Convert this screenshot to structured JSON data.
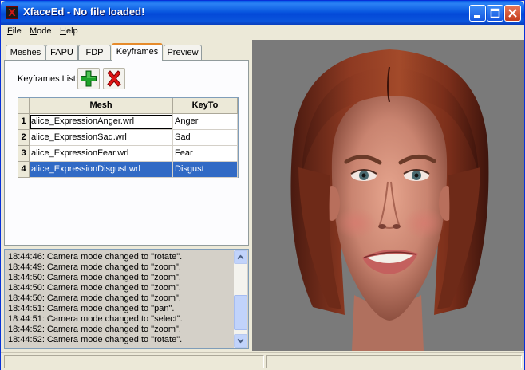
{
  "window": {
    "title": "XfaceEd - No file loaded!",
    "app_icon": "X"
  },
  "menu": [
    {
      "label": "File",
      "accel": "F",
      "rest": "ile"
    },
    {
      "label": "Mode",
      "accel": "M",
      "rest": "ode"
    },
    {
      "label": "Help",
      "accel": "H",
      "rest": "elp"
    }
  ],
  "tabs": [
    {
      "label": "Meshes",
      "active": false
    },
    {
      "label": "FAPU",
      "active": false
    },
    {
      "label": "FDP",
      "active": false
    },
    {
      "label": "Keyframes",
      "active": true
    },
    {
      "label": "Preview",
      "active": false
    }
  ],
  "keyframes": {
    "list_label": "Keyframes List:",
    "add_icon": "plus-icon",
    "delete_icon": "x-delete-icon",
    "columns": [
      "Mesh",
      "KeyTo"
    ],
    "rows": [
      {
        "num": "1",
        "mesh": "alice_ExpressionAnger.wrl",
        "keyto": "Anger",
        "selected": false,
        "focused": true
      },
      {
        "num": "2",
        "mesh": "alice_ExpressionSad.wrl",
        "keyto": "Sad",
        "selected": false,
        "focused": false
      },
      {
        "num": "3",
        "mesh": "alice_ExpressionFear.wrl",
        "keyto": "Fear",
        "selected": false,
        "focused": false
      },
      {
        "num": "4",
        "mesh": "alice_ExpressionDisgust.wrl",
        "keyto": "Disgust",
        "selected": true,
        "focused": false
      }
    ]
  },
  "log": [
    "18:44:46: Camera mode changed to \"rotate\".",
    "18:44:49: Camera mode changed to \"zoom\".",
    "18:44:50: Camera mode changed to \"zoom\".",
    "18:44:50: Camera mode changed to \"zoom\".",
    "18:44:50: Camera mode changed to \"zoom\".",
    "18:44:51: Camera mode changed to \"pan\".",
    "18:44:51: Camera mode changed to \"select\".",
    "18:44:52: Camera mode changed to \"zoom\".",
    "18:44:52: Camera mode changed to \"rotate\"."
  ],
  "colors": {
    "titlebar": "#0a59e0",
    "selection": "#316ac5",
    "viewport_bg": "#7a7a7a",
    "active_tab_accent": "#e68b2c"
  }
}
